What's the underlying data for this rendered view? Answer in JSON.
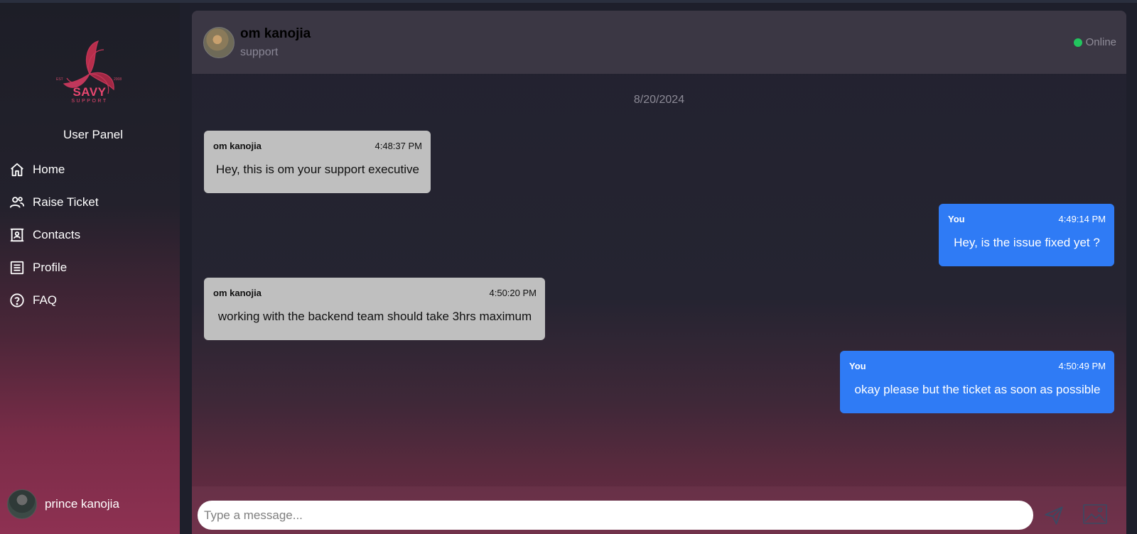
{
  "brand": {
    "name": "SAVY",
    "tagline": "SUPPORT",
    "est": "EST",
    "year": "2008",
    "accent": "#e8466f"
  },
  "sidebar": {
    "panel_title": "User Panel",
    "items": [
      {
        "label": "Home",
        "icon": "home-icon"
      },
      {
        "label": "Raise Ticket",
        "icon": "users-icon"
      },
      {
        "label": "Contacts",
        "icon": "contacts-icon"
      },
      {
        "label": "Profile",
        "icon": "profile-icon"
      },
      {
        "label": "FAQ",
        "icon": "help-icon"
      }
    ],
    "user": {
      "name": "prince kanojia"
    }
  },
  "chat": {
    "contact": {
      "name": "om kanojia",
      "role": "support"
    },
    "status": {
      "label": "Online",
      "color": "#22c55e"
    },
    "date": "8/20/2024",
    "messages": [
      {
        "from": "om kanojia",
        "time": "4:48:37 PM",
        "text": "Hey, this is om your support executive",
        "direction": "incoming"
      },
      {
        "from": "You",
        "time": "4:49:14 PM",
        "text": "Hey, is the issue fixed yet ?",
        "direction": "outgoing"
      },
      {
        "from": "om kanojia",
        "time": "4:50:20 PM",
        "text": "working with the backend team should take 3hrs maximum",
        "direction": "incoming"
      },
      {
        "from": "You",
        "time": "4:50:49 PM",
        "text": "okay please but the ticket as soon as possible",
        "direction": "outgoing"
      }
    ],
    "composer": {
      "placeholder": "Type a message...",
      "value": ""
    },
    "colors": {
      "incoming": "#bfbfbf",
      "outgoing": "#2f7bf5"
    }
  }
}
